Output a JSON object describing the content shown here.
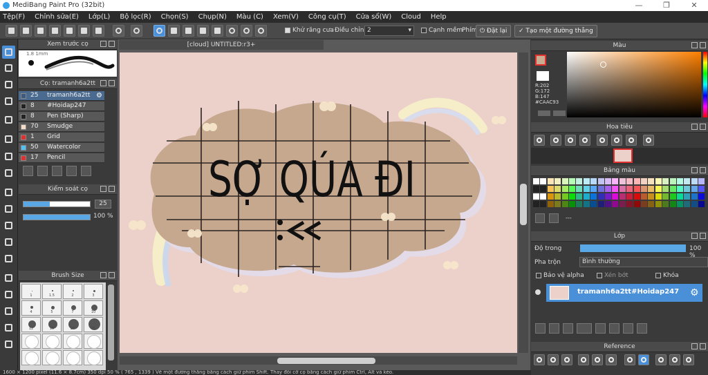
{
  "app": {
    "title": "MediBang Paint Pro (32bit)"
  },
  "menu": [
    "Tệp(F)",
    "Chỉnh sửa(E)",
    "Lớp(L)",
    "Bộ lọc(R)",
    "Chọn(S)",
    "Chụp(N)",
    "Màu (C)",
    "Xem(V)",
    "Công cụ(T)",
    "Cửa sổ(W)",
    "Cloud",
    "Help"
  ],
  "toolbar": {
    "antialias_label": "Khử răng cưa",
    "adjust_label": "Điều chỉnh",
    "adjust_value": "2",
    "smooth_label": "Cạnh mềm",
    "key_label": "Phím",
    "reset_label": "Đặt lại",
    "straight_label": "Tạo một đường thẳng"
  },
  "brush_preview": {
    "title": "Xem trước cọ",
    "size": "1.8 1mm"
  },
  "brush_panel": {
    "title": "Cọ: tramanh6a2tt",
    "items": [
      {
        "size": "25",
        "name": "tramanh6a2tt",
        "color": "#3a5a80"
      },
      {
        "size": "8",
        "name": "#Hoidap247",
        "color": "#222222"
      },
      {
        "size": "8",
        "name": "Pen (Sharp)",
        "color": "#222222"
      },
      {
        "size": "70",
        "name": "Smudge",
        "color": "#f5dcc8"
      },
      {
        "size": "1",
        "name": "Grid",
        "color": "#e03030"
      },
      {
        "size": "50",
        "name": "Watercolor",
        "color": "#4fc3f7"
      },
      {
        "size": "17",
        "name": "Pencil",
        "color": "#e03030"
      }
    ]
  },
  "brush_control": {
    "title": "Kiểm soát cọ",
    "size_value": "25",
    "size_fraction": 0.4,
    "opacity_value": "100 %",
    "opacity_fraction": 1.0
  },
  "brush_size": {
    "title": "Brush Size",
    "labels": [
      "1",
      "1.5",
      "2",
      "3",
      "4",
      "5",
      "7",
      "10",
      "12",
      "15",
      "20",
      "25"
    ]
  },
  "document": {
    "tab": "[cloud] UNTITLED:r3+",
    "artwork_text": "SỢ QÚA ĐI"
  },
  "status": {
    "text": "1600 × 1200 pixel   (11.6 × 8.7cm)   350 dpi   50 %   ( 765 , 1339 )   Vẽ một đường thẳng bằng cách giữ phím Shift. Thay đổi cỡ cọ bằng cách giữ phím Ctrl, Alt và kéo."
  },
  "color_panel": {
    "title": "Màu",
    "r": "R:202",
    "g": "G:172",
    "b": "B:147",
    "hex": "#CAAC93",
    "current": "#caac93"
  },
  "navigator": {
    "title": "Hoa tiêu"
  },
  "palette": {
    "title": "Bảng màu",
    "ellipsis": "---"
  },
  "layer_panel": {
    "title": "Lớp",
    "opacity_label": "Độ trong",
    "opacity_value": "100 %",
    "blend_label": "Pha trộn",
    "blend_value": "Bình thường",
    "protect_alpha": "Bảo vệ alpha",
    "clip": "Xén bớt",
    "lock": "Khóa",
    "layer_name": "tramanh6a2tt#Hoidap247"
  },
  "reference": {
    "title": "Reference"
  }
}
